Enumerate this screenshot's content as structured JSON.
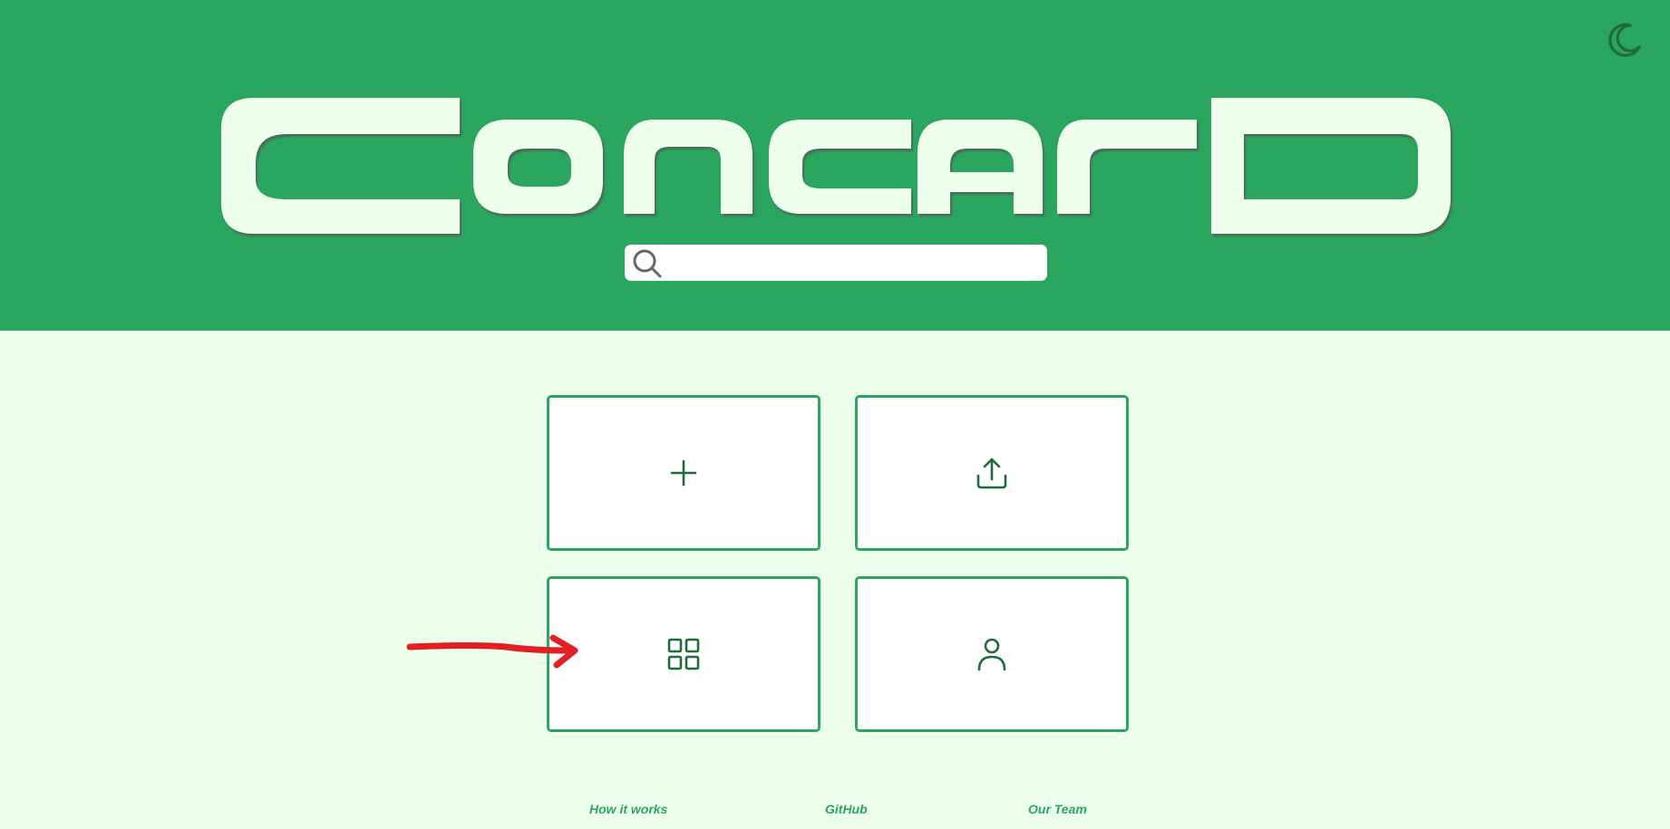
{
  "header": {
    "logo_text": "ConcarD",
    "theme_toggle_icon": "moon-icon",
    "background_color": "#2ba65e"
  },
  "search": {
    "icon": "search-icon",
    "placeholder": "",
    "value": ""
  },
  "cards": [
    {
      "id": "create",
      "icon": "plus-icon"
    },
    {
      "id": "upload",
      "icon": "upload-icon"
    },
    {
      "id": "gallery",
      "icon": "grid-icon"
    },
    {
      "id": "profile",
      "icon": "user-icon"
    }
  ],
  "annotation": {
    "icon": "red-arrow-icon",
    "color": "#e31e24"
  },
  "footer": {
    "how_it_works": "How it works",
    "github": "GitHub",
    "our_team": "Our Team"
  },
  "colors": {
    "accent": "#2ba65e",
    "page_background": "#eefeed",
    "icon_dark": "#1f6b3c",
    "logo_fill": "#eefeed"
  }
}
